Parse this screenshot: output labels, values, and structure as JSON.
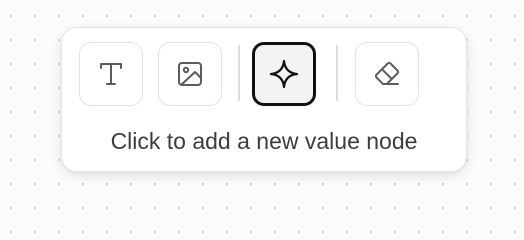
{
  "toolbar": {
    "buttons": [
      {
        "id": "text",
        "icon": "text-icon",
        "active": false
      },
      {
        "id": "image",
        "icon": "image-icon",
        "active": false
      },
      {
        "id": "value",
        "icon": "sparkle-icon",
        "active": true
      },
      {
        "id": "eraser",
        "icon": "eraser-icon",
        "active": false
      }
    ],
    "hint": "Click to add a new value node"
  },
  "colors": {
    "active_border": "#111111",
    "border": "#e3e3e3",
    "icon": "#5c5c5c",
    "text": "#3d3d3d",
    "background": "#fcfcfc"
  }
}
